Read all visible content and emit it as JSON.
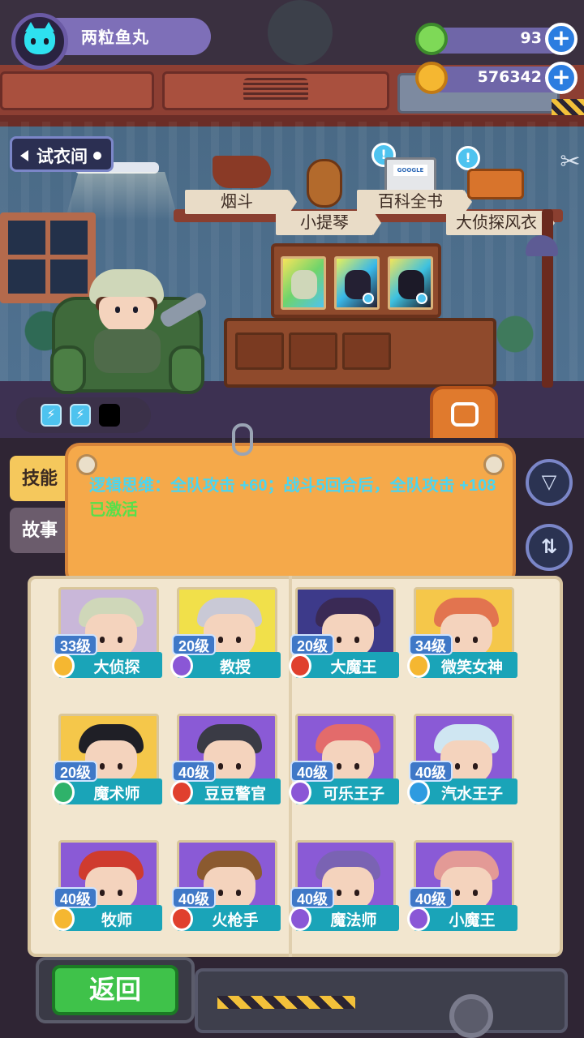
{
  "profile": {
    "name": "两粒鱼丸"
  },
  "currencies": [
    {
      "icon": "green-gem-icon",
      "value": "93",
      "color": "#7ed957"
    },
    {
      "icon": "gold-planet-coin-icon",
      "value": "576342",
      "color": "#f5b731"
    }
  ],
  "nav": {
    "fitting_room": "试衣间"
  },
  "scene_items": [
    {
      "label": "烟斗"
    },
    {
      "label": "小提琴"
    },
    {
      "label": "百科全书"
    },
    {
      "label": "大侦探风衣"
    }
  ],
  "encyclopedia_screen_text": "GOOGLE",
  "energy": {
    "filled": 2,
    "total": 3
  },
  "tabs": [
    {
      "label": "技能",
      "active": true
    },
    {
      "label": "故事",
      "active": false
    }
  ],
  "skill": {
    "text": "逻辑思维：全队攻击 +60；战斗5回合后，全队攻击 +108",
    "status": "已激活"
  },
  "side_buttons": [
    {
      "icon": "filter-icon"
    },
    {
      "icon": "sort-icon"
    }
  ],
  "characters": [
    {
      "level": "33级",
      "name": "大侦探",
      "class_color": "#f5b731",
      "bg": "#c9b7d9",
      "hair": "#cfd7b9"
    },
    {
      "level": "20级",
      "name": "教授",
      "class_color": "#8a57d6",
      "bg": "#f1e04a",
      "hair": "#c9c9d6"
    },
    {
      "level": "20级",
      "name": "大魔王",
      "class_color": "#e0402e",
      "bg": "#3d3a8a",
      "hair": "#3a2a55"
    },
    {
      "level": "34级",
      "name": "微笑女神",
      "class_color": "#f5b731",
      "bg": "#f5c74a",
      "hair": "#e2744f"
    },
    {
      "level": "20级",
      "name": "魔术师",
      "class_color": "#2fb26a",
      "bg": "#f5c74a",
      "hair": "#1f1f26"
    },
    {
      "level": "40级",
      "name": "豆豆警官",
      "class_color": "#e0402e",
      "bg": "#8a5ad6",
      "hair": "#3a3b45"
    },
    {
      "level": "40级",
      "name": "可乐王子",
      "class_color": "#8a57d6",
      "bg": "#8a5ad6",
      "hair": "#e36b6b"
    },
    {
      "level": "40级",
      "name": "汽水王子",
      "class_color": "#2e9be0",
      "bg": "#8a5ad6",
      "hair": "#cfe6f2"
    },
    {
      "level": "40级",
      "name": "牧师",
      "class_color": "#f5b731",
      "bg": "#8a5ad6",
      "hair": "#cf3b2e"
    },
    {
      "level": "40级",
      "name": "火枪手",
      "class_color": "#e0402e",
      "bg": "#8a5ad6",
      "hair": "#8b5a2f"
    },
    {
      "level": "40级",
      "name": "魔法师",
      "class_color": "#8a57d6",
      "bg": "#8a5ad6",
      "hair": "#7a63b3"
    },
    {
      "level": "40级",
      "name": "小魔王",
      "class_color": "#8a57d6",
      "bg": "#8a5ad6",
      "hair": "#e39a96"
    }
  ],
  "footer": {
    "back_label": "返回"
  }
}
